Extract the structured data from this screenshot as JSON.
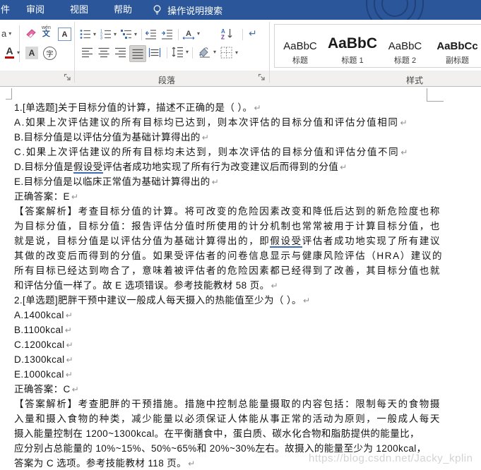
{
  "titlebar": {
    "menu_items": [
      "件",
      "审阅",
      "视图",
      "帮助"
    ],
    "search_label": "操作说明搜索"
  },
  "ribbon": {
    "paragraph_label": "段落",
    "styles_label": "样式",
    "dropdown_glyph": "▾",
    "font_group": {
      "case_letter": "a",
      "color_letter": "A",
      "shade_letter": "A",
      "enclose_letter": "字",
      "phonetic_top": "wén",
      "phonetic_bottom": "文",
      "border_letter": "A"
    },
    "para_group": {
      "sort_a": "A",
      "sort_z": "Z",
      "num1": "1",
      "num2": "2",
      "num3": "3",
      "marks_glyph": "↵"
    },
    "styles": [
      {
        "preview": "AaBbC",
        "label": "标题"
      },
      {
        "preview": "AaBbC",
        "label": "标题 1"
      },
      {
        "preview": "AaBbC",
        "label": "标题 2"
      },
      {
        "preview": "AaBbCc",
        "label": "副标题"
      }
    ]
  },
  "document": {
    "lines": [
      {
        "text": "1.[单选题]关于目标分值的计算，描述不正确的是（ ）。",
        "mark": "↵"
      },
      {
        "text": "A.如果上次评估建议的所有目标均已达到，则本次评估的目标分值和评估分值相同",
        "mark": "↵"
      },
      {
        "text": "B.目标分值是以评估分值为基础计算得出的",
        "mark": "↵"
      },
      {
        "text": "C.如果上次评估建议的所有目标均未达到，则本次评估的目标分值和评估分值不同",
        "mark": "↵"
      },
      {
        "pre": "D.目标分值是",
        "u": "假设受",
        "post": "评估者成功地实现了所有行为改变建议后而得到的分值",
        "mark": "↵"
      },
      {
        "text": "E.目标分值是以临床正常值为基础计算得出的",
        "mark": "↵"
      },
      {
        "text": "正确答案：E",
        "mark": "↵"
      },
      {
        "text": "【答案解析】考查目标分值的计算。将可改变的危险因素改变和降低后达到的新危险度也称"
      },
      {
        "text": "为目标分值，目标分值：报告评估分值时所使用的计分机制也常常被用于计算目标分值，也"
      },
      {
        "pre": "就是说，目标分值是以评估分值为基础计算得出的，即",
        "u": "假设受",
        "post": "评估者成功地实现了所有建议"
      },
      {
        "text": "其做的改变后而得到的分值。如果受评估者的问卷信息显示与健康风险评估（HRA）建议的"
      },
      {
        "text": "所有目标已经达到吻合了，意味着被评估者的危险因素都已经得到了改善，其目标分值也就"
      },
      {
        "text": "和评估分值一样了。故 E 选项错误。参考技能教材 58 页。",
        "mark": "↵"
      },
      {
        "text": "2.[单选题]肥胖干预中建议一般成人每天摄入的热能值至少为（ ）。",
        "mark": "↵"
      },
      {
        "text": "A.1400kcal",
        "mark": "↵"
      },
      {
        "text": "B.1100kcal",
        "mark": "↵"
      },
      {
        "text": "C.1200kcal",
        "mark": "↵"
      },
      {
        "text": "D.1300kcal",
        "mark": "↵"
      },
      {
        "text": "E.1000kcal",
        "mark": "↵"
      },
      {
        "text": "正确答案：C",
        "mark": "↵"
      },
      {
        "text": "【答案解析】考查肥胖的干预措施。措施中控制总能量摄取的内容包括：限制每天的食物摄"
      },
      {
        "text": "入量和摄入食物的种类，减少能量以必须保证人体能从事正常的活动为原则，一般成人每天"
      },
      {
        "text": "摄入能量控制在 1200~1300kcal。在平衡膳食中，蛋白质、碳水化合物和脂肪提供的能量比，"
      },
      {
        "text": "应分别占总能量的 10%~15%、50%~65%和 20%~30%左右。故摄入的能量至少为 1200kcal，"
      },
      {
        "text": "答案为 C 选项。参考技能教材 118 页。",
        "mark": "↵"
      }
    ]
  },
  "watermark": "https://blog.csdn.net/Jacky_kplin"
}
